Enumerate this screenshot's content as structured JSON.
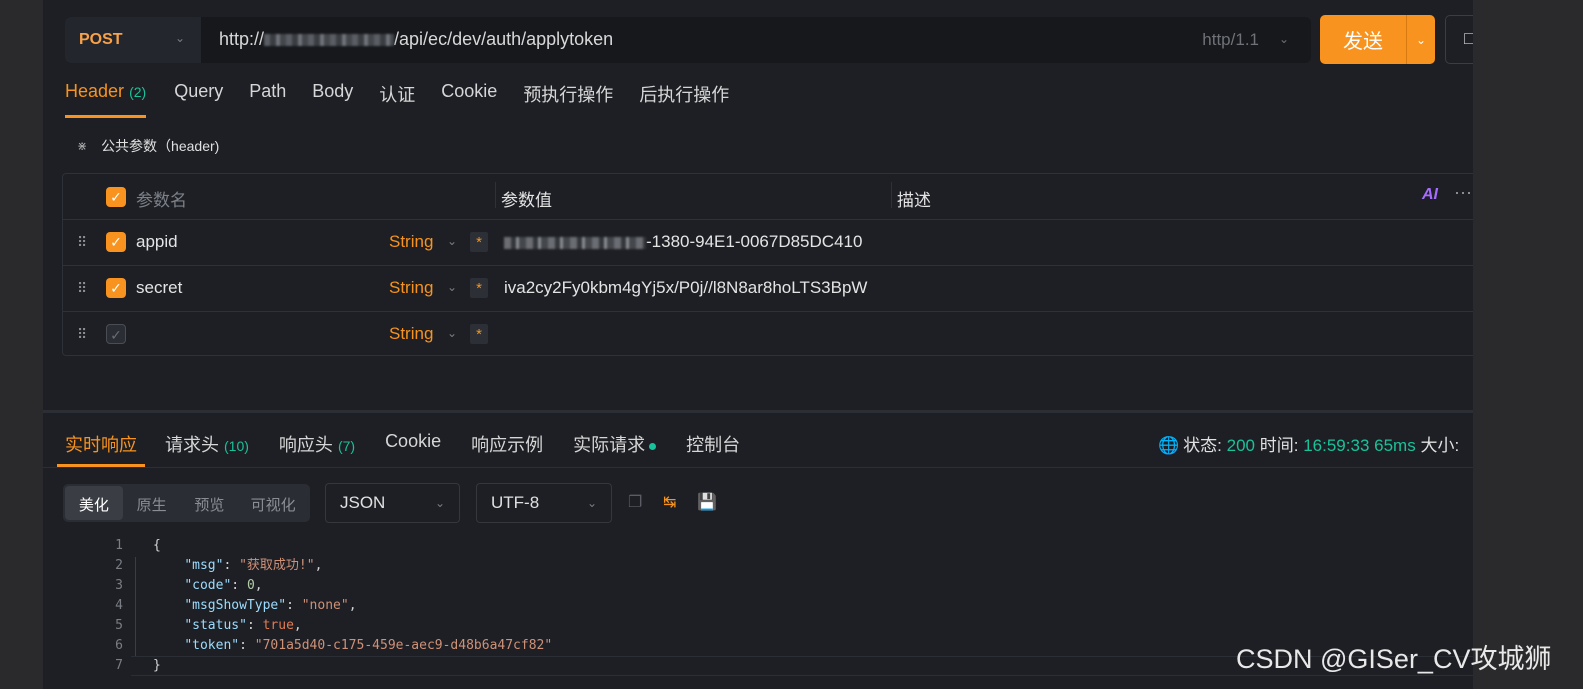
{
  "request": {
    "method": "POST",
    "url_prefix": "http://",
    "url_suffix": "/api/ec/dev/auth/applytoken",
    "protocol": "http/1.1",
    "send_label": "发送",
    "extra_icon": "window-icon"
  },
  "tabs": [
    {
      "label": "Header",
      "count": "(2)",
      "active": true
    },
    {
      "label": "Query"
    },
    {
      "label": "Path"
    },
    {
      "label": "Body"
    },
    {
      "label": "认证"
    },
    {
      "label": "Cookie"
    },
    {
      "label": "预执行操作"
    },
    {
      "label": "后执行操作"
    }
  ],
  "public_params": {
    "label": "公共参数（header)"
  },
  "params_table": {
    "headers": {
      "name": "参数名",
      "value": "参数值",
      "desc": "描述"
    },
    "ai_label": "AI",
    "more_label": "···",
    "rows": [
      {
        "name": "appid",
        "type": "String",
        "required": "*",
        "value_visible": "-1380-94E1-0067D85DC410",
        "checked": true
      },
      {
        "name": "secret",
        "type": "String",
        "required": "*",
        "value_visible": "iva2cy2Fy0kbm4gYj5x/P0j//l8N8ar8hoLTS3BpW",
        "checked": true
      },
      {
        "name": "",
        "type": "String",
        "required": "*",
        "value_visible": "",
        "checked": false
      }
    ]
  },
  "response": {
    "tabs": [
      {
        "label": "实时响应",
        "active": true
      },
      {
        "label": "请求头",
        "count": "(10)"
      },
      {
        "label": "响应头",
        "count": "(7)"
      },
      {
        "label": "Cookie"
      },
      {
        "label": "响应示例"
      },
      {
        "label": "实际请求",
        "dot": true
      },
      {
        "label": "控制台"
      }
    ],
    "status_label": "状态:",
    "status_value": "200",
    "time_label": "时间:",
    "time_value": "16:59:33",
    "duration": "65ms",
    "size_label": "大小:",
    "view_modes": [
      "美化",
      "原生",
      "预览",
      "可视化"
    ],
    "format": "JSON",
    "encoding": "UTF-8",
    "code_lines": [
      {
        "n": "1",
        "text": "{"
      },
      {
        "n": "2",
        "key": "\"msg\"",
        "val": "\"获取成功!\"",
        "type": "s",
        "comma": ","
      },
      {
        "n": "3",
        "key": "\"code\"",
        "val": "0",
        "type": "n",
        "comma": ","
      },
      {
        "n": "4",
        "key": "\"msgShowType\"",
        "val": "\"none\"",
        "type": "s",
        "comma": ","
      },
      {
        "n": "5",
        "key": "\"status\"",
        "val": "true",
        "type": "b",
        "comma": ","
      },
      {
        "n": "6",
        "key": "\"token\"",
        "val": "\"701a5d40-c175-459e-aec9-d48b6a47cf82\"",
        "type": "s",
        "comma": ""
      },
      {
        "n": "7",
        "text": "}"
      }
    ]
  },
  "watermark": "CSDN @GISer_CV攻城狮",
  "colors": {
    "accent": "#f7931e",
    "success": "#19c29a",
    "bg": "#1d1f24"
  }
}
